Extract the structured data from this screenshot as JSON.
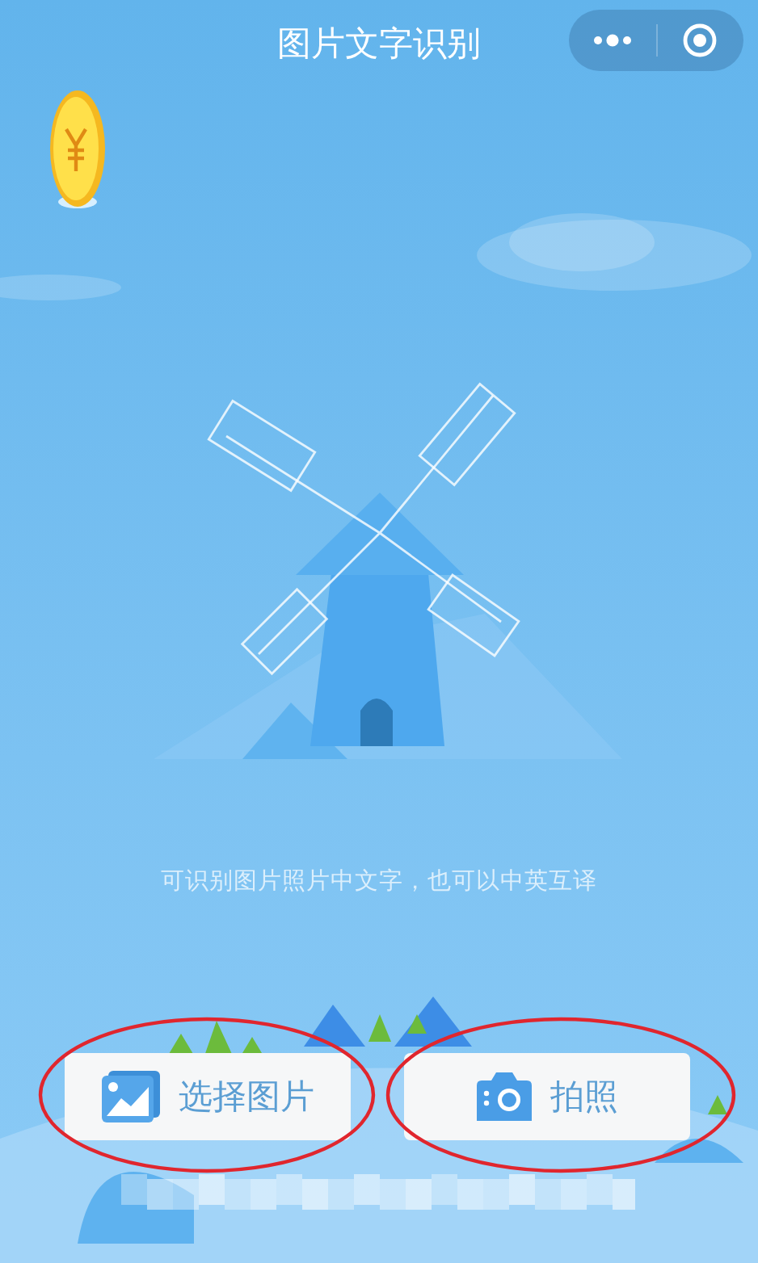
{
  "nav_bar": {
    "title": "图片文字识别"
  },
  "caption": "可识别图片照片中文字，也可以中英互译",
  "buttons": [
    {
      "label": "选择图片",
      "kind": "album",
      "circled": true
    },
    {
      "label": "拍照",
      "kind": "camera",
      "circled": true
    }
  ]
}
